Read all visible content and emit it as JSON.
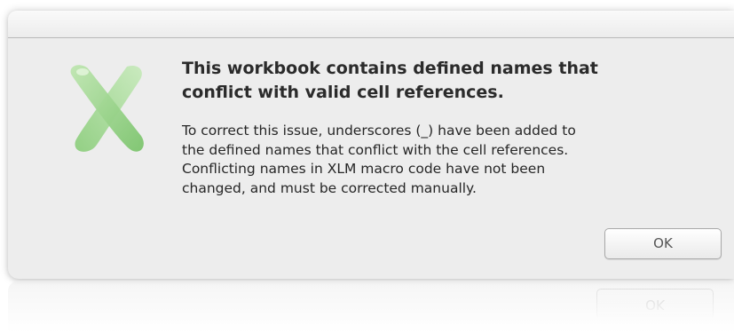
{
  "dialog": {
    "heading": "This workbook contains defined names that\nconflict with valid cell references.",
    "message": "To correct this issue, underscores (_) have been added to\nthe defined names that conflict with the cell references.\nConflicting names in XLM macro code have not been\nchanged, and must be corrected manually.",
    "ok_label": "OK",
    "icon": "excel-x-icon"
  },
  "colors": {
    "dialog_background": "#ededed",
    "icon_green": "#79c46c"
  }
}
